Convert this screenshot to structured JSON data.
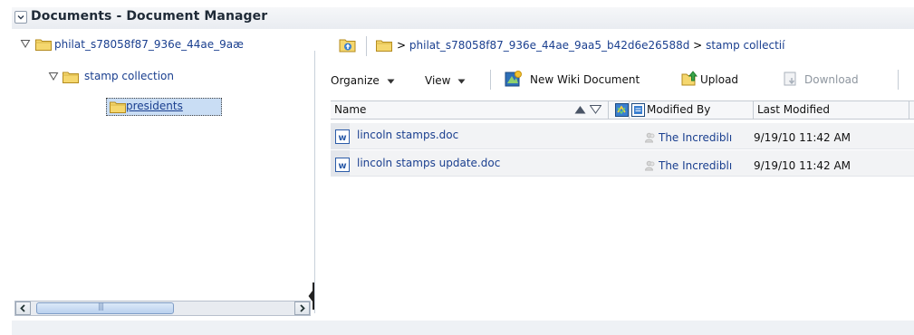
{
  "panel": {
    "title": "Documents - Document Manager"
  },
  "tree": {
    "root_label": "philat_s78058f87_936e_44ae_9aæ",
    "child_label": "stamp collection",
    "grandchild_label": "presidents"
  },
  "breadcrumb": {
    "separator_1": ">",
    "path_segment_1": "philat_s78058f87_936e_44ae_9aa5_b42d6e26588d",
    "separator_2": ">",
    "path_segment_2": "stamp collectií"
  },
  "toolbar": {
    "organize_label": "Organize",
    "view_label": "View",
    "new_wiki_label": "New Wiki Document",
    "upload_label": "Upload",
    "download_label": "Download"
  },
  "table": {
    "columns": {
      "name": "Name",
      "modified_by": "Modified By",
      "last_modified": "Last Modified"
    },
    "rows": [
      {
        "name": "lincoln stamps.doc",
        "modified_by": "The Incrediblı",
        "last_modified": "9/19/10 11:42 AM"
      },
      {
        "name": "lincoln stamps update.doc",
        "modified_by": "The Incrediblı",
        "last_modified": "9/19/10 11:42 AM"
      }
    ]
  },
  "scrollbar": {
    "thumb_grip": "|||"
  },
  "icons": {
    "collapse": "chevron-down-icon",
    "disclosure": "triangle-down-outline-icon",
    "folder": "folder-icon",
    "word_doc": "word-document-icon",
    "user": "user-icon"
  },
  "colors": {
    "folder_fill": "#f5d76e",
    "link_blue": "#1a3f8f",
    "selection_bg": "#c9ddf4"
  }
}
